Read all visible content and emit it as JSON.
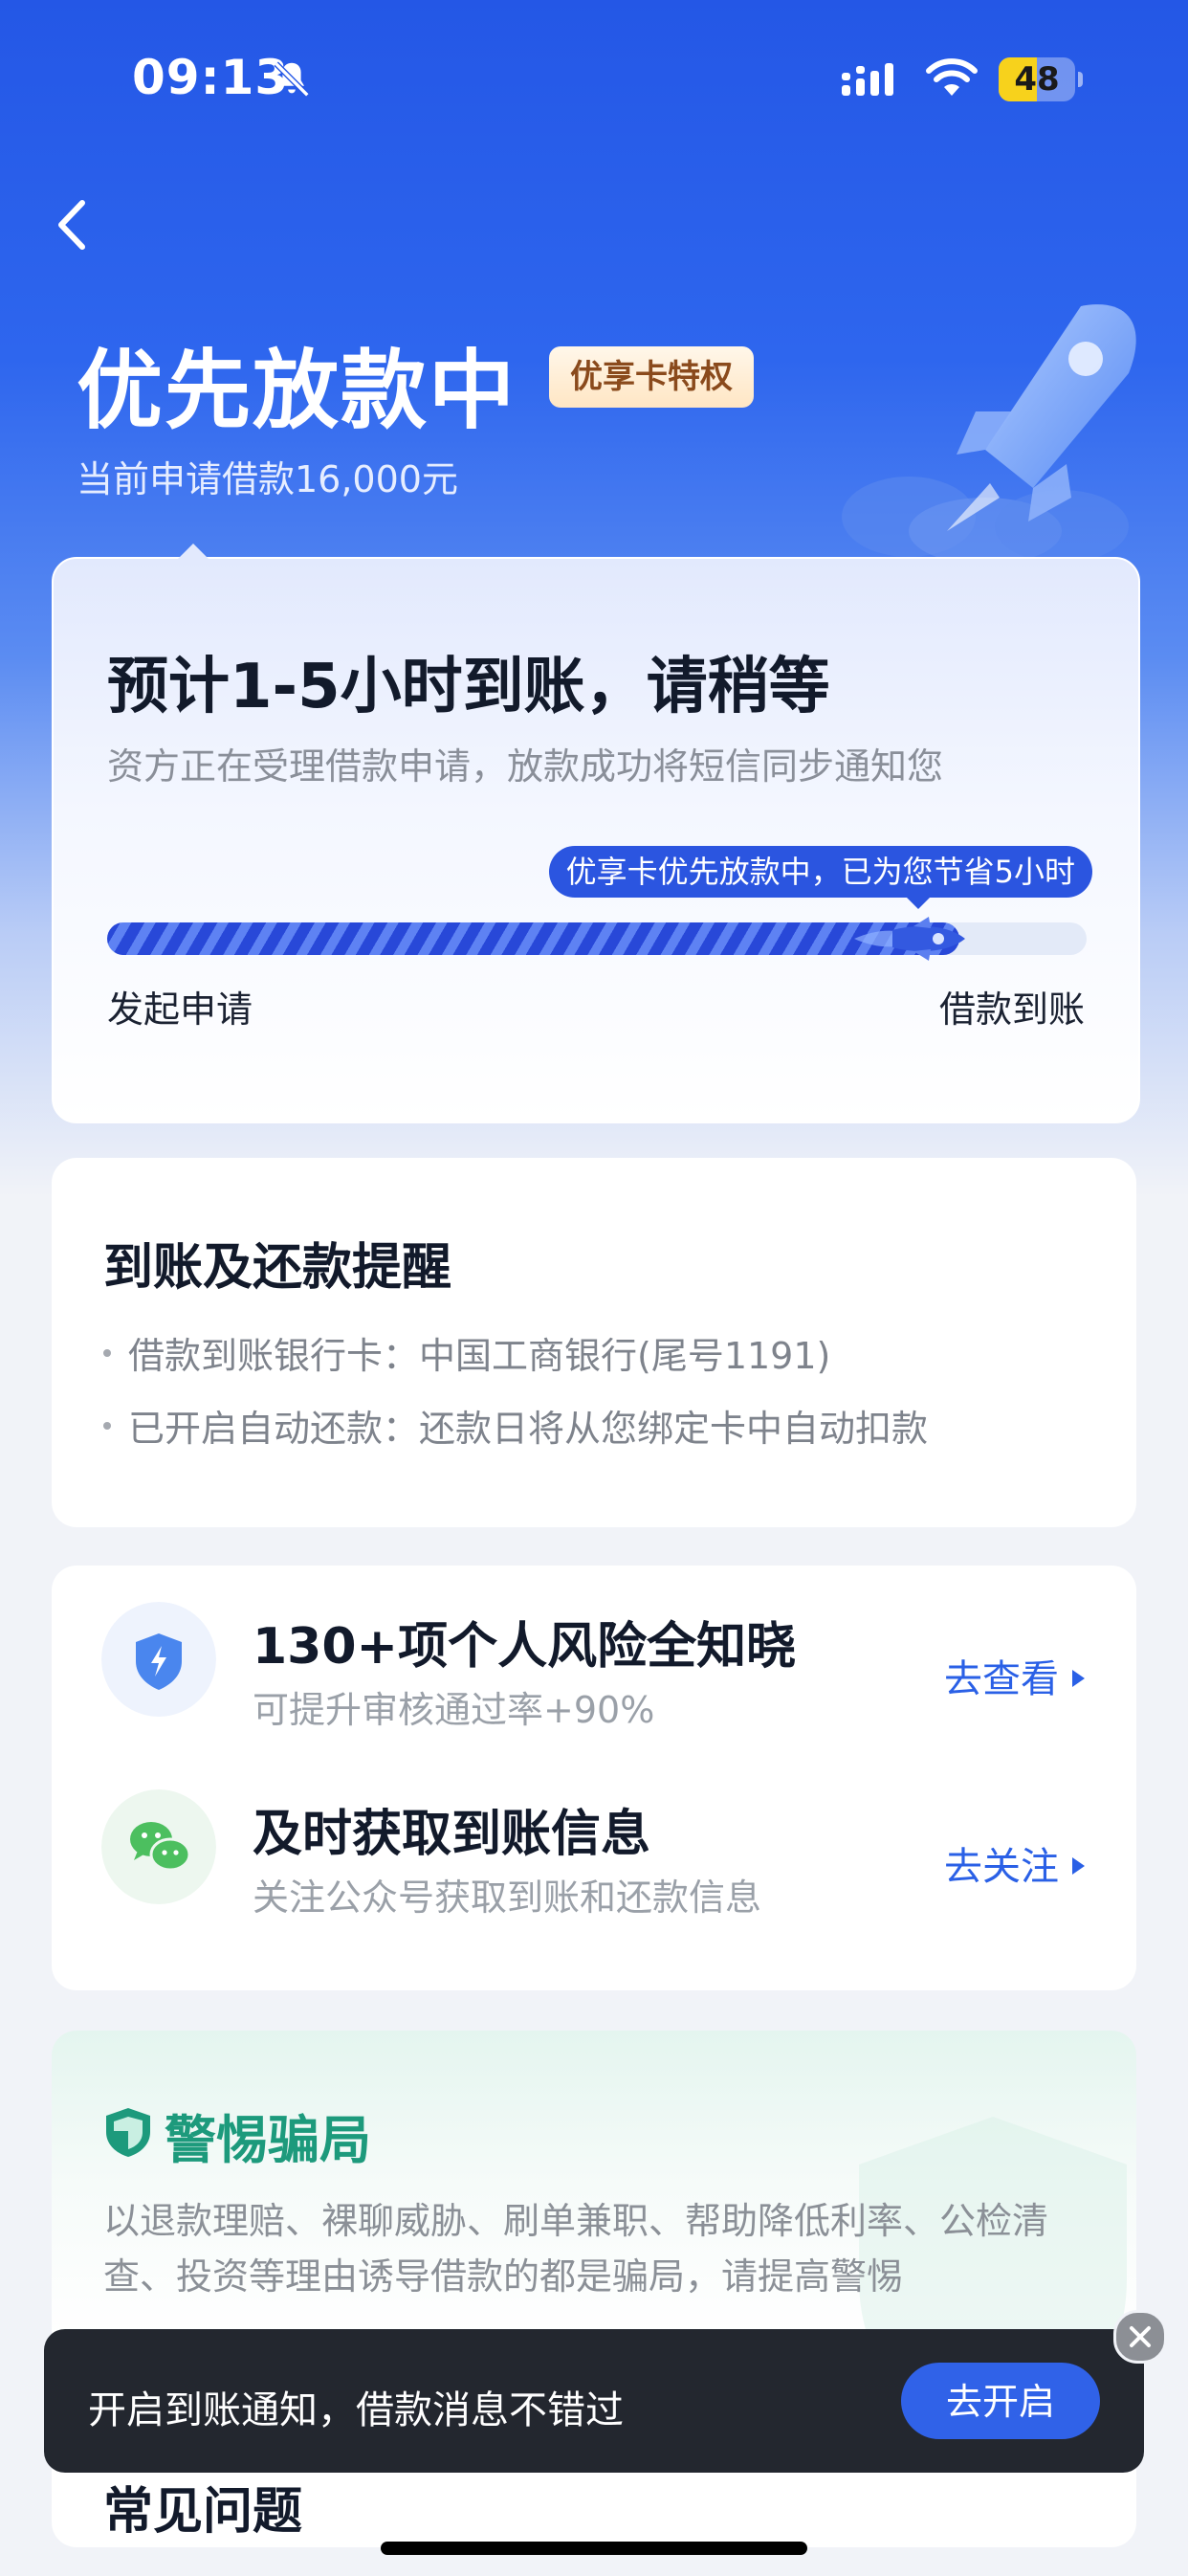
{
  "status_bar": {
    "time": "09:13",
    "battery": "48"
  },
  "header": {
    "title": "优先放款中",
    "badge": "优享卡特权",
    "subtitle": "当前申请借款16,000元"
  },
  "progress": {
    "headline": "预计1-5小时到账，请稍等",
    "description": "资方正在受理借款申请，放款成功将短信同步通知您",
    "tip": "优享卡优先放款中，已为您节省5小时",
    "fraction": 0.87,
    "start_label": "发起申请",
    "end_label": "借款到账"
  },
  "reminder": {
    "title": "到账及还款提醒",
    "lines": [
      "借款到账银行卡：中国工商银行(尾号1191)",
      "已开启自动还款：还款日将从您绑定卡中自动扣款"
    ]
  },
  "features": [
    {
      "title": "130+项个人风险全知晓",
      "subtitle": "可提升审核通过率+90%",
      "link": "去查看",
      "icon": "shield-lightning-icon"
    },
    {
      "title": "及时获取到账信息",
      "subtitle": "关注公众号获取到账和还款信息",
      "link": "去关注",
      "icon": "wechat-icon"
    }
  ],
  "warning": {
    "title": "警惕骗局",
    "text": "以退款理赔、裸聊威胁、刷单兼职、帮助降低利率、公检清查、投资等理由诱导借款的都是骗局，请提高警惕"
  },
  "faq": {
    "title": "常见问题"
  },
  "toast": {
    "text": "开启到账通知，借款消息不错过",
    "button": "去开启"
  },
  "colors": {
    "primary": "#2b55e0",
    "warning_green": "#1d9a7c",
    "badge_text": "#8a4a1c"
  }
}
